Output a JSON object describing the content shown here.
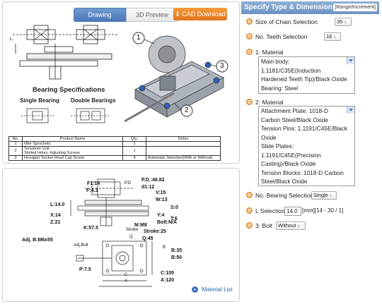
{
  "tabs": {
    "drawing": "Drawing",
    "preview": "3D Preview",
    "cad": "CAD Download"
  },
  "diagram_top": {
    "callouts": [
      "1",
      "2",
      "3"
    ],
    "bearing": {
      "title": "Bearing Specifications",
      "single": "Single Bearing",
      "double": "Double Bearings"
    },
    "dim_l": "L"
  },
  "bom": {
    "headers": [
      "No.",
      "Product Name",
      "Qty.",
      "Notes"
    ],
    "rows": [
      [
        "1",
        "Idler Sprockets",
        "1",
        ""
      ],
      [
        "2",
        "Tensioner Unit\nSlotted Holes, Adjusting Screws",
        "1",
        ""
      ],
      [
        "3",
        "Hexagon Socket Head Cap Screw",
        "4",
        "Automatic Selection(With or Without)"
      ]
    ]
  },
  "dims": {
    "f1": "F1:14",
    "f": "F:4.3",
    "pd": "P.D.:48.82",
    "d1": "d1:12",
    "v": "V:15",
    "w": "W:13",
    "l": "L:14.0",
    "s": "S:0",
    "x": "X:14",
    "z": "Z:21",
    "y": "Y:4",
    "bolt": "Bolt:N/A",
    "t": "T:6",
    "k": "K:57.5",
    "m": "M:M8",
    "stroke_lbl": "Stroke",
    "stroke": "Stroke:25",
    "q": "Q:45",
    "adj": "Adj. B:M6x55",
    "b35": "B:35",
    "b50": "B:50",
    "p": "P:7.5",
    "c": "C:105",
    "a": "A:120",
    "adjbolt": "Adj.Bolt",
    "bsmall": "B",
    "csmall": "C",
    "asmall": "A",
    "pdsmall": "P.D",
    "qsmall": "Q"
  },
  "material_list": "Material List",
  "specify": {
    "header": "Specify Type & Dimension",
    "range": "[Range/Increment]",
    "size_label": "Size of Chain Selection",
    "size_value": "35",
    "teeth_label": "No. Teeth Selection",
    "teeth_value": "16",
    "mat1_label": "1: Material",
    "mat1_lines": [
      "Main body:",
      "1.1181/C35E(Induction",
      "Hardened Teeth Tip)/Black Oxide",
      "Bearing: Steel"
    ],
    "mat2_label": "2: Material",
    "mat2_lines": [
      "Attachment Plate: 1018-D",
      "Carbon Steel/Black Oxide",
      "Tension Pins: 1.1191/C45E/Black",
      "Oxide",
      "Slide Plates:",
      "1.1191/C45E(Precision",
      "Casting)/Black Oxide",
      "Tension Blocks: 1018-D Carbon",
      "Steel/Black Oxide"
    ],
    "bearing_label": "No. Bearing Selection",
    "bearing_value": "Single",
    "lsel_label": "L Selection",
    "lsel_value": "14.0",
    "lsel_range": "[mm][14 - 30 / 1]",
    "bolt_label": "3: Bolt",
    "bolt_value": "Without"
  },
  "colors": {
    "accent": "#4b78b8",
    "cad": "#e8842a",
    "header": "#7c9fcb"
  }
}
